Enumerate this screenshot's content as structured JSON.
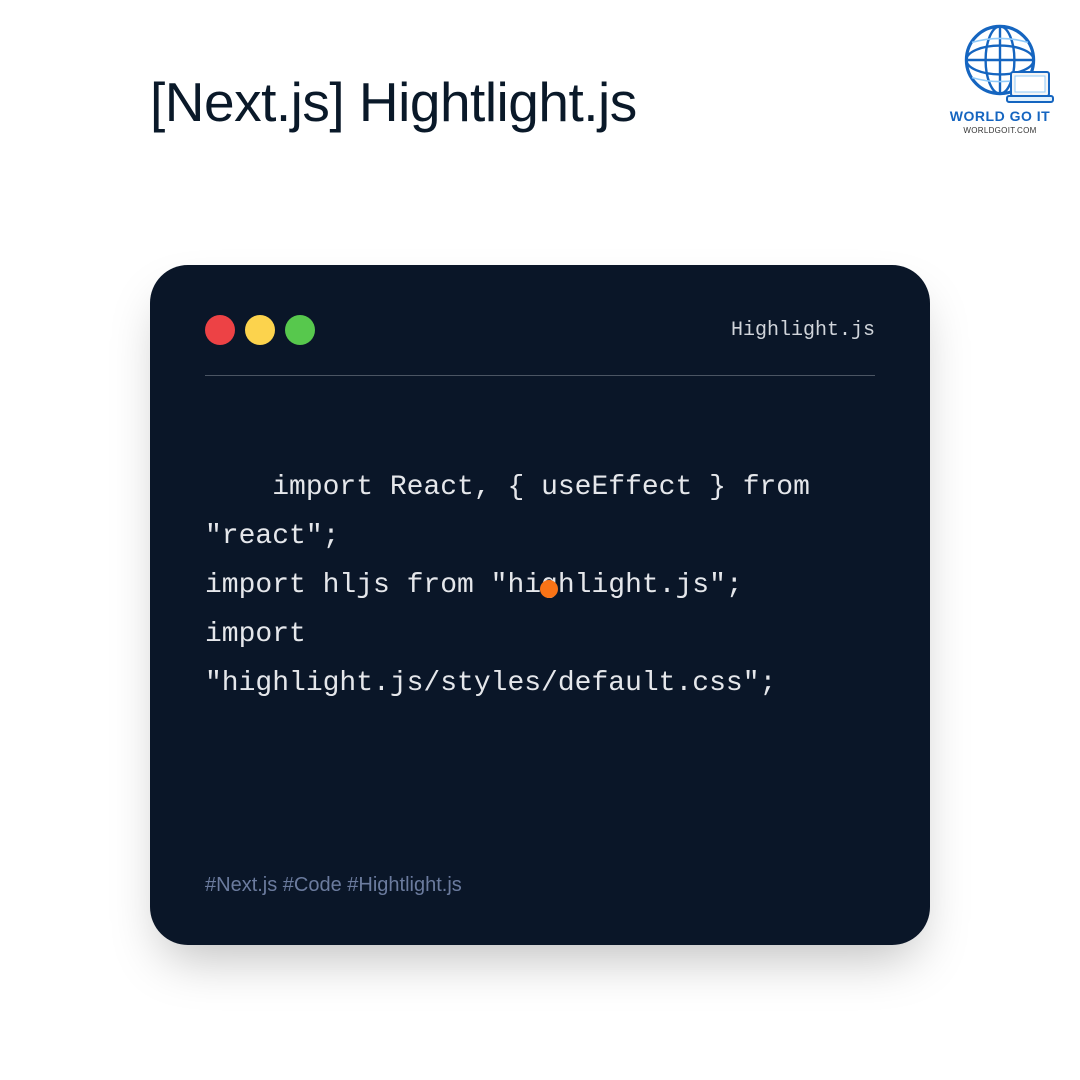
{
  "title": "[Next.js] Hightlight.js",
  "logo": {
    "text": "WORLD GO IT",
    "url": "WORLDGOIT.COM"
  },
  "window": {
    "title": "Highlight.js",
    "code": "import React, { useEffect } from \"react\";\nimport hljs from \"highlight.js\";\nimport \"highlight.js/styles/default.css\";",
    "hashtags": "#Next.js #Code #Hightlight.js"
  }
}
